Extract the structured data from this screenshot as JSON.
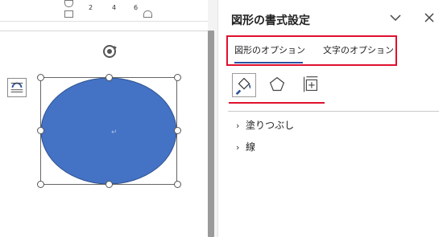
{
  "ruler": {
    "ticks": [
      "2",
      "4",
      "6"
    ]
  },
  "pane": {
    "title": "図形の書式設定",
    "tabs": [
      {
        "label": "図形のオプション",
        "selected": true
      },
      {
        "label": "文字のオプション",
        "selected": false
      }
    ],
    "icons": [
      {
        "name": "fill-line-icon",
        "active": true
      },
      {
        "name": "effects-pentagon-icon",
        "active": false
      },
      {
        "name": "size-properties-icon",
        "active": false
      }
    ],
    "sections": [
      {
        "label": "塗りつぶし",
        "expanded": false
      },
      {
        "label": "線",
        "expanded": false
      }
    ]
  },
  "shape": {
    "type": "ellipse",
    "fill": "#4472c4",
    "stroke": "#2f528f",
    "anchor_mark": "↵"
  },
  "colors": {
    "highlight": "#e0102f",
    "tab_underline": "#2b4fa3",
    "pane_border": "#e2e2e2"
  }
}
